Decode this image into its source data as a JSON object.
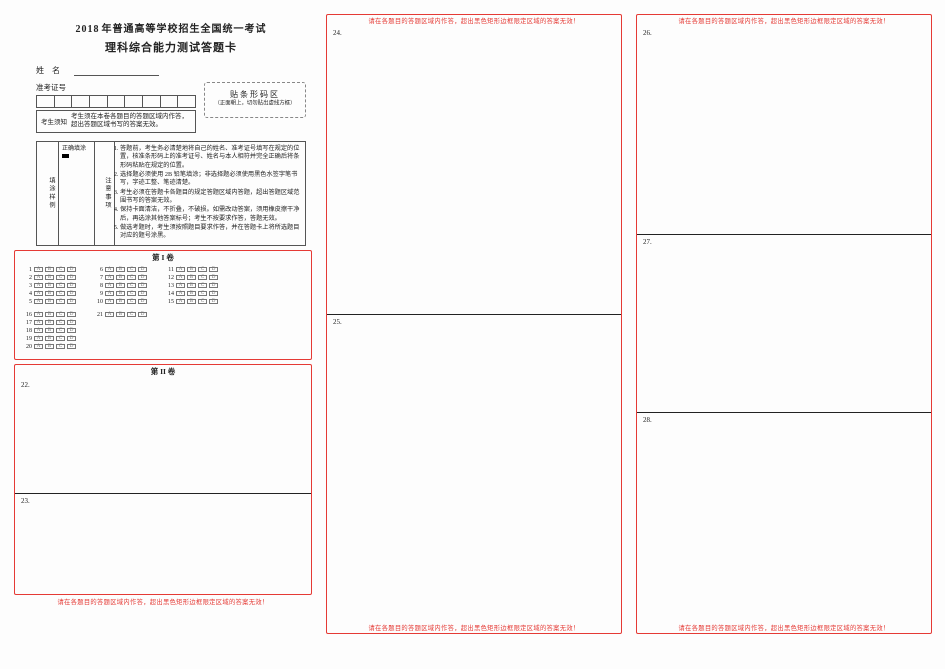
{
  "header": {
    "year": "2018",
    "title_line1_rest": "年普通高等学校招生全国统一考试",
    "title_line2": "理科综合能力测试答题卡",
    "name_label": "姓名",
    "id_label": "准考证号",
    "id_cell_count": 9,
    "exam_note_label": "考生须知",
    "exam_note_text": "考生须在本卷各题目的答题区域内作答，超出答题区域书写的答案无效。"
  },
  "barcode": {
    "title": "贴条形码区",
    "subtitle": "（正面朝上，切勿贴出虚线方框）"
  },
  "fill_example": {
    "col1_label": "填涂样例",
    "col2_label": "正确填涂",
    "col3_label": "注意事项"
  },
  "notice_items": [
    "答题前，考生务必清楚地将自己的姓名、准考证号填写在规定的位置，核准条形码上的准考证号、姓名与本人相符并完全正确后将条形码粘贴在规定的位置。",
    "选择题必须使用 2B 铅笔填涂；非选择题必须使用黑色水签字笔书写，字迹工整、笔迹清楚。",
    "考生必须在答题卡各题目的规定答题区域内答题，超出答题区域范围书写的答案无效。",
    "保持卡面清洁，不折叠，不破损。如需改动答案，须用橡皮擦干净后，再选涂其他答案标号；考生不按要求作答，答题无效。",
    "做选考题时，考生须按照题目要求作答，并在答题卡上将所选题目对应的题号涂黑。"
  ],
  "section1": {
    "title": "第 I 卷",
    "groups": [
      {
        "start": 1,
        "end": 5,
        "options": [
          "A",
          "B",
          "C",
          "D"
        ]
      },
      {
        "start": 6,
        "end": 10,
        "options": [
          "A",
          "B",
          "C",
          "D"
        ]
      },
      {
        "start": 11,
        "end": 15,
        "options": [
          "A",
          "B",
          "C",
          "D"
        ]
      },
      {
        "start": 16,
        "end": 20,
        "options": [
          "A",
          "B",
          "C",
          "D"
        ]
      },
      {
        "start": 21,
        "end": 21,
        "options": [
          "A",
          "B",
          "C",
          "D"
        ]
      }
    ]
  },
  "section2": {
    "title": "第 II 卷",
    "left_questions": [
      {
        "n": "22."
      },
      {
        "n": "23."
      }
    ],
    "mid_questions": [
      {
        "n": "24."
      },
      {
        "n": "25."
      }
    ],
    "right_questions": [
      {
        "n": "26."
      },
      {
        "n": "27."
      },
      {
        "n": "28."
      }
    ]
  },
  "red_warning": "请在各题目的答题区域内作答，超出黑色矩形边框限定区域的答案无效！"
}
